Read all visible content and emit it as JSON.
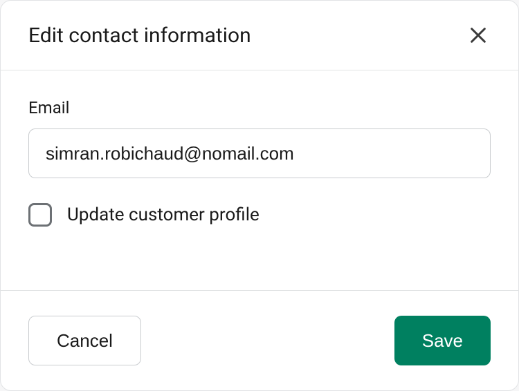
{
  "modal": {
    "title": "Edit contact information"
  },
  "form": {
    "email_label": "Email",
    "email_value": "simran.robichaud@nomail.com",
    "update_profile_label": "Update customer profile",
    "update_profile_checked": false
  },
  "footer": {
    "cancel_label": "Cancel",
    "save_label": "Save"
  },
  "colors": {
    "primary": "#008060",
    "border": "#c9cccf",
    "text": "#1a1a1a"
  }
}
